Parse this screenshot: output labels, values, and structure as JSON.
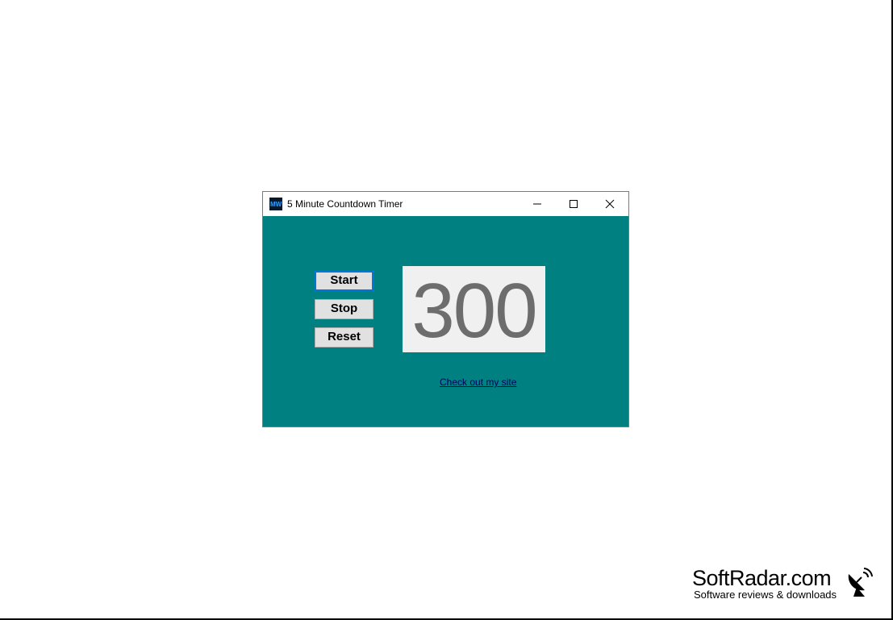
{
  "window": {
    "title": "5 Minute Countdown Timer",
    "icon": "mw-app-icon",
    "controls": [
      "minimize-icon",
      "maximize-icon",
      "close-icon"
    ]
  },
  "buttons": {
    "start": "Start",
    "stop": "Stop",
    "reset": "Reset"
  },
  "display": {
    "seconds": "300"
  },
  "link": {
    "text": "Check out my site"
  },
  "watermark": {
    "name": "SoftRadar.com",
    "tagline": "Software reviews & downloads",
    "icon": "satellite-dish-icon"
  },
  "colors": {
    "client_background": "#008080",
    "display_background": "#f0f0f0",
    "display_text": "#6d6d6d",
    "focus_border": "#0078d7"
  }
}
